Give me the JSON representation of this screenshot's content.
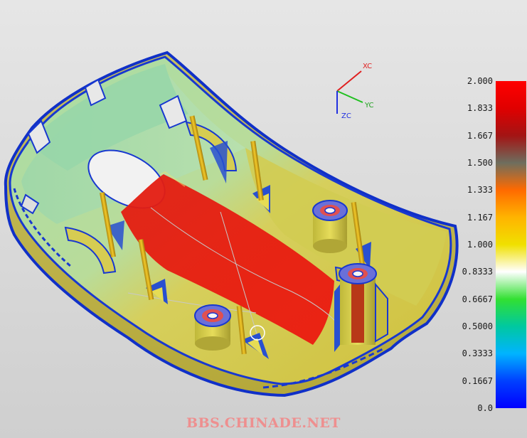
{
  "axes": {
    "x": "XC",
    "y": "YC",
    "z": "ZC"
  },
  "legend": {
    "labels": [
      "2.000",
      "1.833",
      "1.667",
      "1.500",
      "1.333",
      "1.167",
      "1.000",
      "0.8333",
      "0.6667",
      "0.5000",
      "0.3333",
      "0.1667",
      "0.0"
    ],
    "min": 0.0,
    "max": 2.0,
    "colors": [
      "#ff0000",
      "#e00000",
      "#a31414",
      "#6e6e5e",
      "#ff6a00",
      "#ffb400",
      "#f0e000",
      "#ffffff",
      "#32e032",
      "#00c8a0",
      "#00b4ff",
      "#0040ff",
      "#0000ff"
    ]
  },
  "watermark": "BBS.CHINADE.NET",
  "colors": {
    "background": "#dcdcdc",
    "shell_yellow": "#d6cc48",
    "shell_green": "#a6dba6",
    "edge_blue": "#1030c8",
    "hot_red": "#e81c10",
    "rib_orange": "#e0a800"
  }
}
